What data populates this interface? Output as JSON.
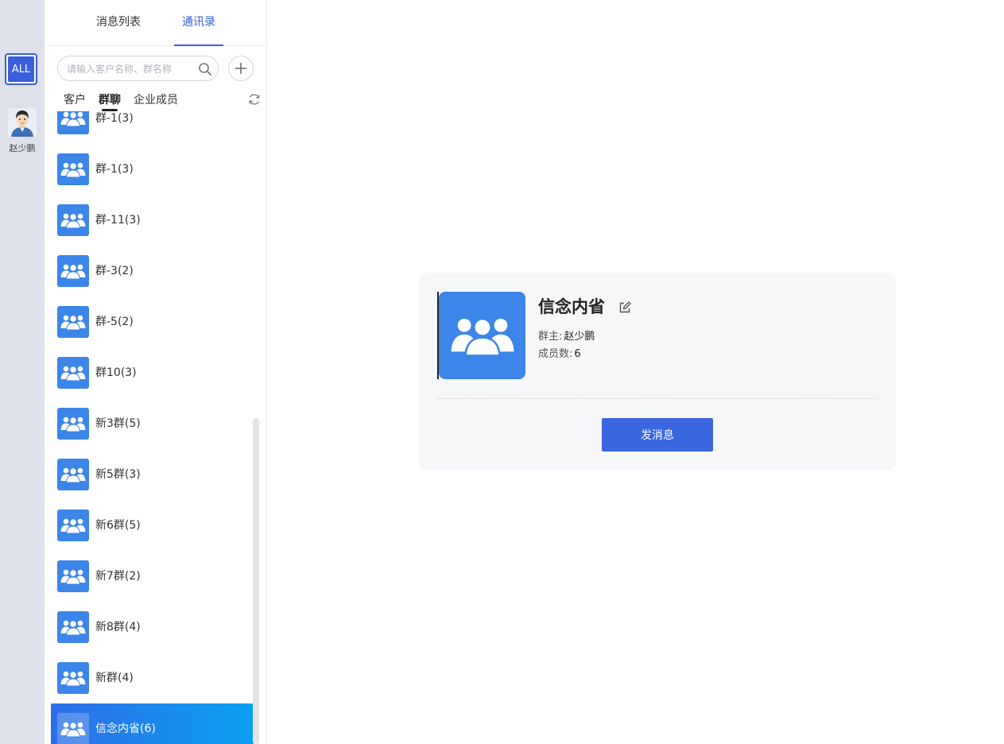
{
  "rail": {
    "all_label": "ALL",
    "account_name": "赵少鹏"
  },
  "panel": {
    "tabs": [
      {
        "label": "消息列表"
      },
      {
        "label": "通讯录",
        "active": true
      }
    ],
    "search": {
      "placeholder": "请输入客户名称、群名称",
      "value": ""
    },
    "subtabs": [
      {
        "label": "客户"
      },
      {
        "label": "群聊",
        "active": true
      },
      {
        "label": "企业成员"
      }
    ],
    "groups": [
      {
        "name": "群-1(3)"
      },
      {
        "name": "群-1(3)"
      },
      {
        "name": "群-11(3)"
      },
      {
        "name": "群-3(2)"
      },
      {
        "name": "群-5(2)"
      },
      {
        "name": "群10(3)"
      },
      {
        "name": "新3群(5)"
      },
      {
        "name": "新5群(3)"
      },
      {
        "name": "新6群(5)"
      },
      {
        "name": "新7群(2)"
      },
      {
        "name": "新8群(4)"
      },
      {
        "name": "新群(4)"
      },
      {
        "name": "信念内省(6)",
        "selected": true
      }
    ]
  },
  "detail": {
    "name": "信念内省",
    "owner_label": "群主:",
    "owner": "赵少鹏",
    "members_label": "成员数:",
    "members": "6",
    "send_label": "发消息"
  },
  "icons": {
    "group": "group-avatar-icon",
    "search": "search-icon",
    "add": "plus-icon",
    "refresh": "refresh-icon",
    "edit": "edit-icon"
  },
  "colors": {
    "accent": "#3a5fd9",
    "avatar_blue": "#3b86e8",
    "selected_gradient_start": "#2f6ee8",
    "selected_gradient_end": "#0aa0f0",
    "button_blue": "#3a66e0"
  }
}
